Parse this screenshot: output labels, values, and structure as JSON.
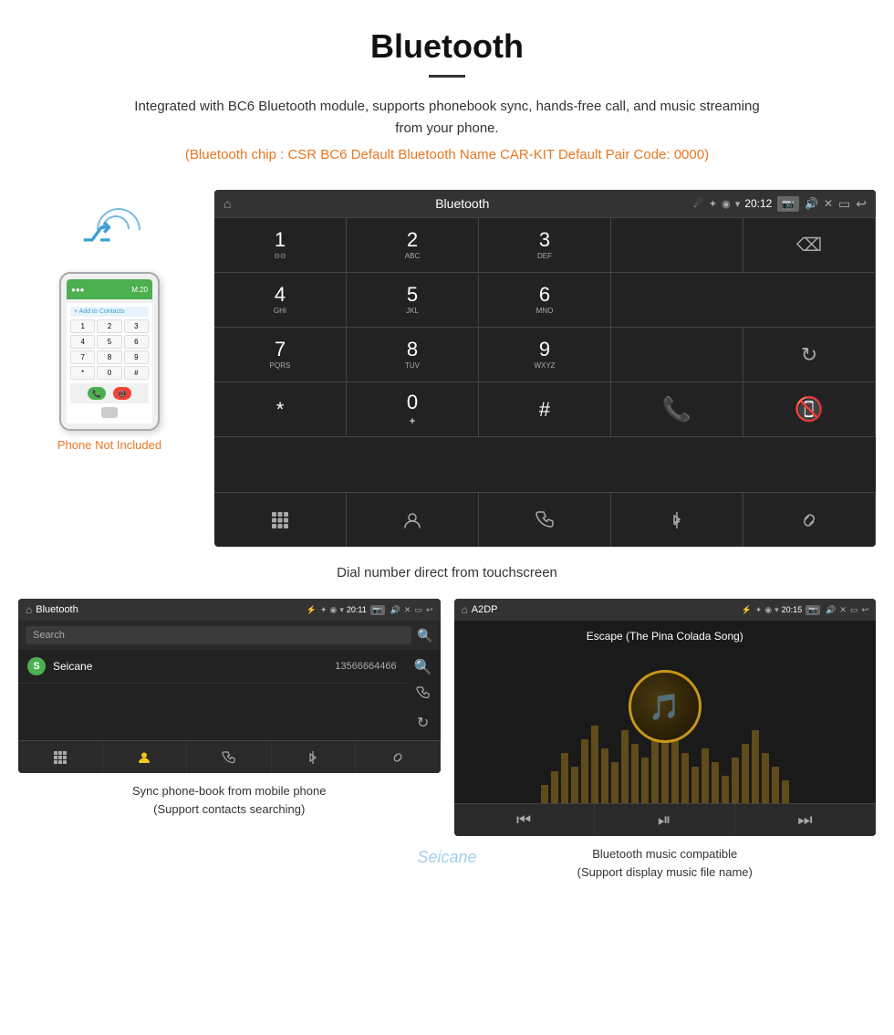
{
  "header": {
    "title": "Bluetooth",
    "description": "Integrated with BC6 Bluetooth module, supports phonebook sync, hands-free call, and music streaming from your phone.",
    "specs": "(Bluetooth chip : CSR BC6    Default Bluetooth Name CAR-KIT    Default Pair Code: 0000)"
  },
  "dial_screen": {
    "status_bar": {
      "home_icon": "⌂",
      "title": "Bluetooth",
      "usb_icon": "⚡",
      "bt_icon": "✦",
      "location_icon": "◉",
      "signal_icon": "▾",
      "time": "20:12",
      "cam_label": "📷",
      "volume_icon": "🔊",
      "x_icon": "✕",
      "back_icon": "↩"
    },
    "keypad": [
      {
        "num": "1",
        "letters": "⊙⊙",
        "row": 0,
        "col": 0
      },
      {
        "num": "2",
        "letters": "ABC",
        "row": 0,
        "col": 1
      },
      {
        "num": "3",
        "letters": "DEF",
        "row": 0,
        "col": 2
      },
      {
        "num": "4",
        "letters": "GHI",
        "row": 1,
        "col": 0
      },
      {
        "num": "5",
        "letters": "JKL",
        "row": 1,
        "col": 1
      },
      {
        "num": "6",
        "letters": "MNO",
        "row": 1,
        "col": 2
      },
      {
        "num": "7",
        "letters": "PQRS",
        "row": 2,
        "col": 0
      },
      {
        "num": "8",
        "letters": "TUV",
        "row": 2,
        "col": 1
      },
      {
        "num": "9",
        "letters": "WXYZ",
        "row": 2,
        "col": 2
      },
      {
        "num": "*",
        "letters": "",
        "row": 3,
        "col": 0
      },
      {
        "num": "0",
        "letters": "+",
        "row": 3,
        "col": 1
      },
      {
        "num": "#",
        "letters": "",
        "row": 3,
        "col": 2
      }
    ]
  },
  "phone_illustration": {
    "top_bar_text": "M:20",
    "add_contact": "+ Add to Contacts",
    "keys": [
      "1",
      "2",
      "3",
      "4",
      "5",
      "6",
      "7",
      "8",
      "9",
      "*",
      "0",
      "#"
    ]
  },
  "phone_not_included": "Phone Not Included",
  "dial_caption": "Dial number direct from touchscreen",
  "phonebook_screen": {
    "status_bar": {
      "home_icon": "⌂",
      "title": "Bluetooth",
      "usb_icon": "⚡",
      "bt_icon": "✦",
      "time": "20:11"
    },
    "search_placeholder": "Search",
    "contacts": [
      {
        "initial": "S",
        "name": "Seicane",
        "number": "13566664466"
      }
    ]
  },
  "music_screen": {
    "status_bar": {
      "home_icon": "⌂",
      "title": "A2DP",
      "usb_icon": "⚡",
      "bt_icon": "✦",
      "time": "20:15"
    },
    "song_title": "Escape (The Pina Colada Song)",
    "visualizer_bars": [
      20,
      35,
      55,
      40,
      70,
      85,
      60,
      45,
      80,
      65,
      50,
      75,
      90,
      70,
      55,
      40,
      60,
      45,
      30,
      50,
      65,
      80,
      55,
      40,
      25
    ]
  },
  "phonebook_caption_line1": "Sync phone-book from mobile phone",
  "phonebook_caption_line2": "(Support contacts searching)",
  "music_caption_line1": "Bluetooth music compatible",
  "music_caption_line2": "(Support display music file name)",
  "seicane_watermark": "Seicane"
}
